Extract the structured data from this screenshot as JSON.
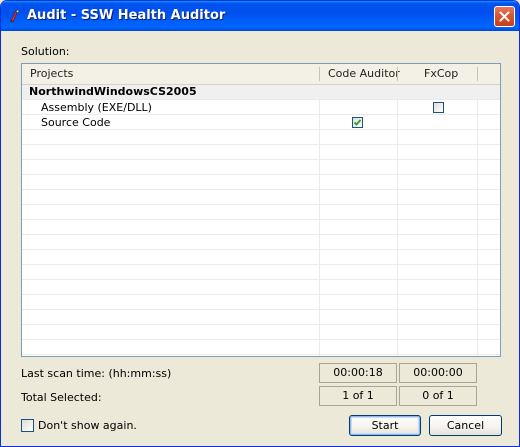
{
  "window": {
    "title": "Audit - SSW Health Auditor"
  },
  "solution_label": "Solution:",
  "grid": {
    "columns": [
      "Projects",
      "Code Auditor",
      "FxCop"
    ],
    "group": "NorthwindWindowsCS2005",
    "rows": [
      {
        "label": "Assembly (EXE/DLL)",
        "code_auditor": null,
        "fxcop": false
      },
      {
        "label": "Source Code",
        "code_auditor": true,
        "fxcop": null
      }
    ]
  },
  "last_scan": {
    "label": "Last scan time: (hh:mm:ss)",
    "code_auditor": "00:00:18",
    "fxcop": "00:00:00"
  },
  "total_selected": {
    "label": "Total Selected:",
    "code_auditor": "1 of 1",
    "fxcop": "0 of 1"
  },
  "dont_show": {
    "label": "Don't show again.",
    "checked": false
  },
  "buttons": {
    "start": "Start",
    "cancel": "Cancel"
  },
  "colors": {
    "titlebar": "#0053ee",
    "window_bg": "#ece9d8",
    "checkmark": "#21a121"
  },
  "icons": {
    "app": "audit-app-icon",
    "close": "close-icon"
  }
}
